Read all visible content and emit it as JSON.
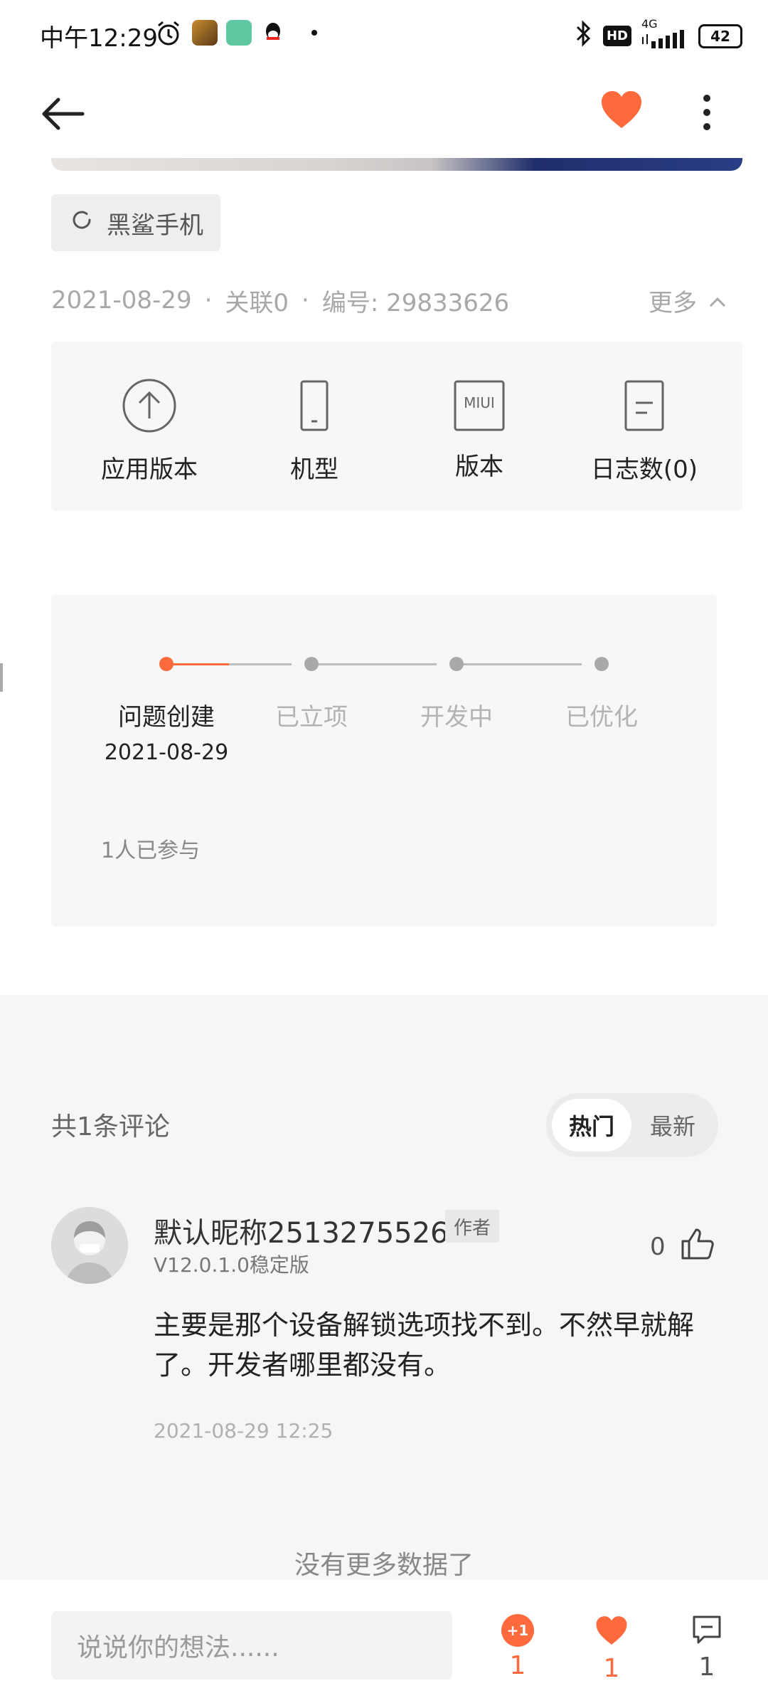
{
  "status_bar": {
    "time": "中午12:29",
    "network": "4G",
    "hd_label": "HD",
    "battery": "42"
  },
  "nav": {
    "back_icon": "arrow-left-icon",
    "favorite_icon": "heart-icon",
    "more_icon": "more-vertical-icon",
    "accent_color": "#ff6a3d"
  },
  "tag": {
    "label": "黑鲨手机"
  },
  "meta": {
    "date": "2021-08-29",
    "related": "关联0",
    "number": "编号: 29833626",
    "more_label": "更多"
  },
  "info_panel": {
    "items": [
      {
        "icon": "upload-circle-icon",
        "label": "应用版本"
      },
      {
        "icon": "phone-icon",
        "label": "机型"
      },
      {
        "icon": "miui-icon",
        "label": "版本",
        "icon_text": "MIUI"
      },
      {
        "icon": "document-icon",
        "label": "日志数(0)"
      }
    ]
  },
  "progress": {
    "steps": [
      {
        "label": "问题创建",
        "date": "2021-08-29",
        "active": true
      },
      {
        "label": "已立项",
        "active": false
      },
      {
        "label": "开发中",
        "active": false
      },
      {
        "label": "已优化",
        "active": false
      }
    ],
    "participants": "1人已参与"
  },
  "comments": {
    "title": "共1条评论",
    "sort_options": [
      "热门",
      "最新"
    ],
    "sort_selected": "热门",
    "items": [
      {
        "nickname": "默认昵称2513275526",
        "badge": "作者",
        "version": "V12.0.1.0稳定版",
        "likes": "0",
        "text": "主要是那个设备解锁选项找不到。不然早就解了。开发者哪里都没有。",
        "time": "2021-08-29 12:25"
      }
    ],
    "no_more": "没有更多数据了"
  },
  "bottom_bar": {
    "input_placeholder": "说说你的想法......",
    "plus_one_label": "+1",
    "plus_one_count": "1",
    "like_count": "1",
    "comment_count": "1"
  }
}
